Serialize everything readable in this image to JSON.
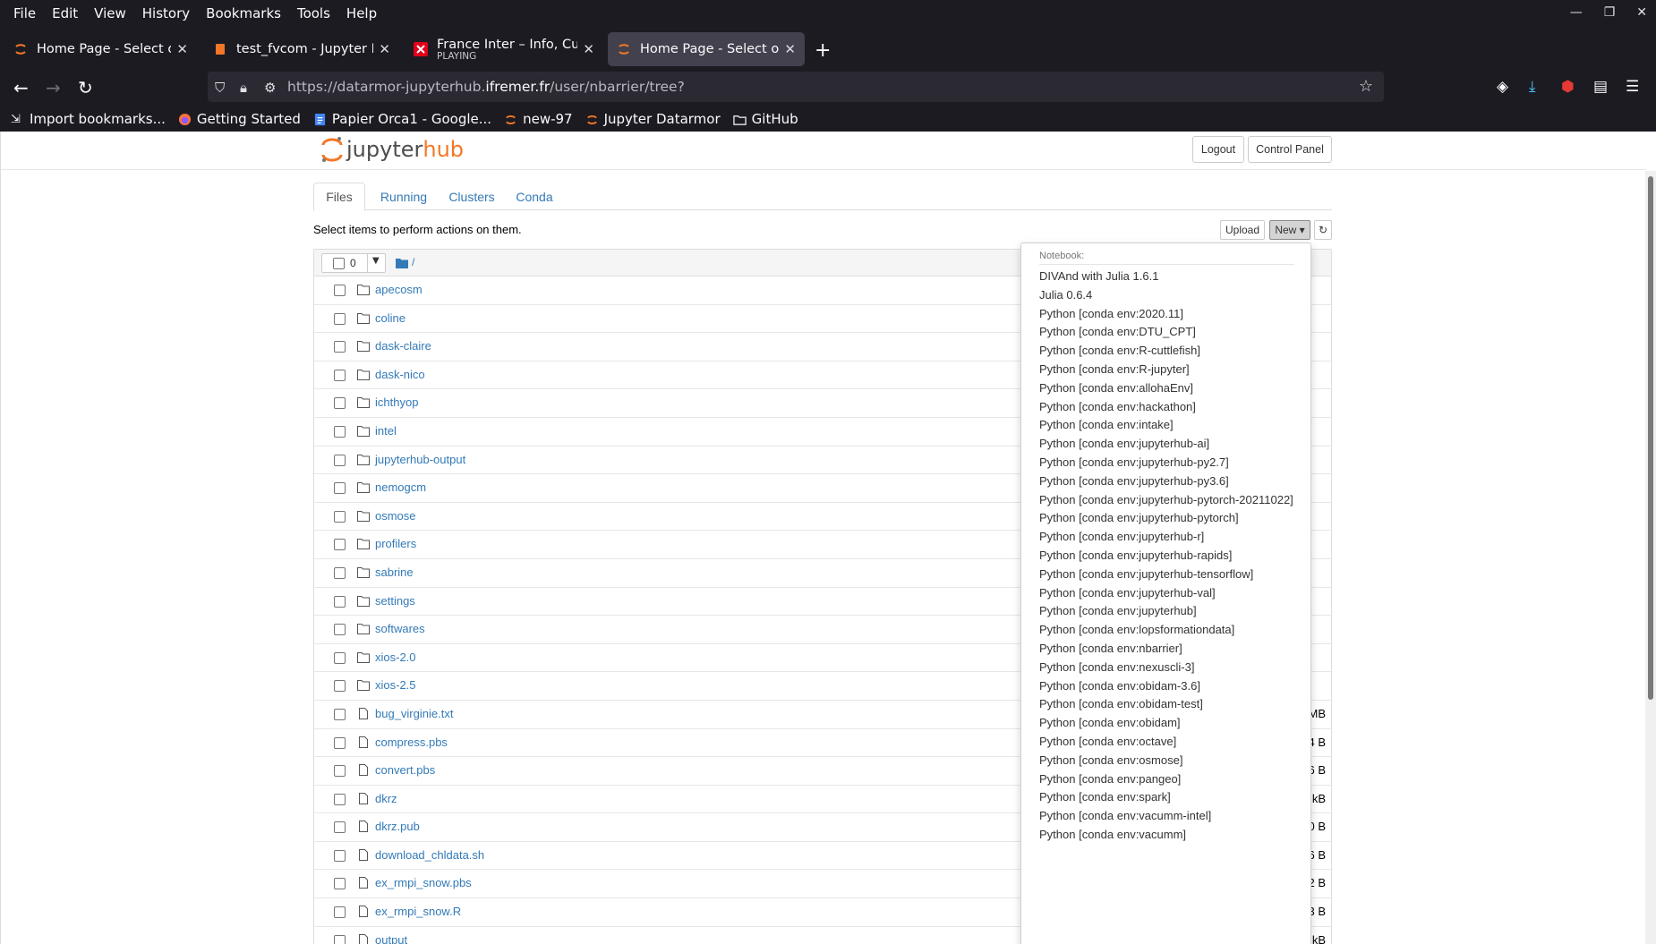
{
  "menubar": [
    "File",
    "Edit",
    "View",
    "History",
    "Bookmarks",
    "Tools",
    "Help"
  ],
  "window_controls": {
    "minimize": "—",
    "restore": "❐",
    "close": "✕"
  },
  "tabs": [
    {
      "title": "Home Page - Select or cre",
      "active": false
    },
    {
      "title": "test_fvcom - Jupyter Not",
      "active": false
    },
    {
      "title": "France Inter – Info, Cultur",
      "subtitle": "PLAYING",
      "active": false
    },
    {
      "title": "Home Page - Select or cre",
      "active": true
    }
  ],
  "new_tab_symbol": "+",
  "url": {
    "prefix": "https://datarmor-jupyterhub.",
    "domain": "ifremer.fr",
    "path": "/user/nbarrier/tree?"
  },
  "bookmarks": [
    {
      "label": "Import bookmarks...",
      "icon": "import-icon"
    },
    {
      "label": "Getting Started",
      "icon": "firefox-icon"
    },
    {
      "label": "Papier Orca1 - Google...",
      "icon": "google-docs-icon"
    },
    {
      "label": "new-97",
      "icon": "jupyter-icon"
    },
    {
      "label": "Jupyter Datarmor",
      "icon": "jupyter-icon"
    },
    {
      "label": "GitHub",
      "icon": "folder-icon"
    }
  ],
  "header": {
    "logo_jupyter": "jupyter",
    "logo_hub": "hub",
    "logout": "Logout",
    "control_panel": "Control Panel"
  },
  "page_tabs": [
    "Files",
    "Running",
    "Clusters",
    "Conda"
  ],
  "select_hint": "Select items to perform actions on them.",
  "toolbar": {
    "upload": "Upload",
    "new": "New ▾",
    "refresh": "↻"
  },
  "list_header": {
    "selected_count": "0",
    "path": "/"
  },
  "files": [
    {
      "name": "apecosm",
      "type": "folder",
      "size": ""
    },
    {
      "name": "coline",
      "type": "folder",
      "size": ""
    },
    {
      "name": "dask-claire",
      "type": "folder",
      "size": ""
    },
    {
      "name": "dask-nico",
      "type": "folder",
      "size": ""
    },
    {
      "name": "ichthyop",
      "type": "folder",
      "size": ""
    },
    {
      "name": "intel",
      "type": "folder",
      "size": ""
    },
    {
      "name": "jupyterhub-output",
      "type": "folder",
      "size": ""
    },
    {
      "name": "nemogcm",
      "type": "folder",
      "size": ""
    },
    {
      "name": "osmose",
      "type": "folder",
      "size": ""
    },
    {
      "name": "profilers",
      "type": "folder",
      "size": ""
    },
    {
      "name": "sabrine",
      "type": "folder",
      "size": ""
    },
    {
      "name": "settings",
      "type": "folder",
      "size": ""
    },
    {
      "name": "softwares",
      "type": "folder",
      "size": ""
    },
    {
      "name": "xios-2.0",
      "type": "folder",
      "size": ""
    },
    {
      "name": "xios-2.5",
      "type": "folder",
      "size": ""
    },
    {
      "name": "bug_virginie.txt",
      "type": "file",
      "size": "MB"
    },
    {
      "name": "compress.pbs",
      "type": "file",
      "size": "4 B"
    },
    {
      "name": "convert.pbs",
      "type": "file",
      "size": "6 B"
    },
    {
      "name": "dkrz",
      "type": "file",
      "size": "kB"
    },
    {
      "name": "dkrz.pub",
      "type": "file",
      "size": "0 B"
    },
    {
      "name": "download_chldata.sh",
      "type": "file",
      "size": "6 B"
    },
    {
      "name": "ex_rmpi_snow.pbs",
      "type": "file",
      "size": "2 B"
    },
    {
      "name": "ex_rmpi_snow.R",
      "type": "file",
      "size": "3 B"
    },
    {
      "name": "output",
      "type": "file",
      "size": "kB"
    }
  ],
  "dropdown": {
    "header": "Notebook:",
    "items": [
      "DIVAnd with Julia 1.6.1",
      "Julia 0.6.4",
      "Python [conda env:2020.11]",
      "Python [conda env:DTU_CPT]",
      "Python [conda env:R-cuttlefish]",
      "Python [conda env:R-jupyter]",
      "Python [conda env:allohaEnv]",
      "Python [conda env:hackathon]",
      "Python [conda env:intake]",
      "Python [conda env:jupyterhub-ai]",
      "Python [conda env:jupyterhub-py2.7]",
      "Python [conda env:jupyterhub-py3.6]",
      "Python [conda env:jupyterhub-pytorch-20211022]",
      "Python [conda env:jupyterhub-pytorch]",
      "Python [conda env:jupyterhub-r]",
      "Python [conda env:jupyterhub-rapids]",
      "Python [conda env:jupyterhub-tensorflow]",
      "Python [conda env:jupyterhub-val]",
      "Python [conda env:jupyterhub]",
      "Python [conda env:lopsformationdata]",
      "Python [conda env:nbarrier]",
      "Python [conda env:nexuscli-3]",
      "Python [conda env:obidam-3.6]",
      "Python [conda env:obidam-test]",
      "Python [conda env:obidam]",
      "Python [conda env:octave]",
      "Python [conda env:osmose]",
      "Python [conda env:pangeo]",
      "Python [conda env:spark]",
      "Python [conda env:vacumm-intel]",
      "Python [conda env:vacumm]"
    ]
  },
  "colors": {
    "link": "#337ab7",
    "jupyter_orange": "#f37726",
    "chrome_bg": "#1c1b22"
  }
}
